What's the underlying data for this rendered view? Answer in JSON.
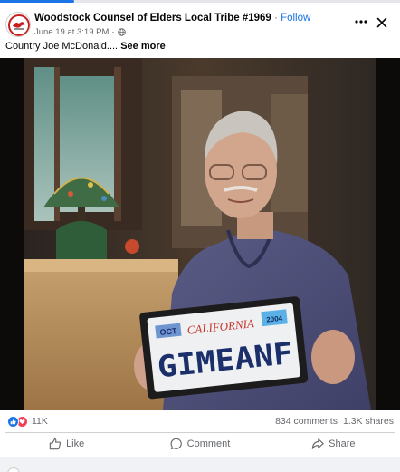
{
  "post": {
    "page_name": "Woodstock Counsel of Elders Local Tribe #1969",
    "separator": "·",
    "follow_label": "Follow",
    "date": "June 19 at 3:19 PM",
    "meta_separator": "·",
    "audience_icon": "globe-icon",
    "caption": "Country Joe McDonald....",
    "see_more_label": "See more"
  },
  "photo": {
    "plate_top_left": "OCT",
    "plate_state": "CALIFORNIA",
    "plate_sticker": "2004",
    "plate_text": "GIMEANF"
  },
  "stats": {
    "reaction_icons": [
      "like-reaction-icon",
      "love-reaction-icon"
    ],
    "reaction_count": "11K",
    "comments": "834 comments",
    "shares": "1.3K shares"
  },
  "actions": {
    "like_label": "Like",
    "comment_label": "Comment",
    "share_label": "Share"
  },
  "colors": {
    "accent": "#1b74e4",
    "love": "#f33e58",
    "secondary_text": "#65676b"
  }
}
